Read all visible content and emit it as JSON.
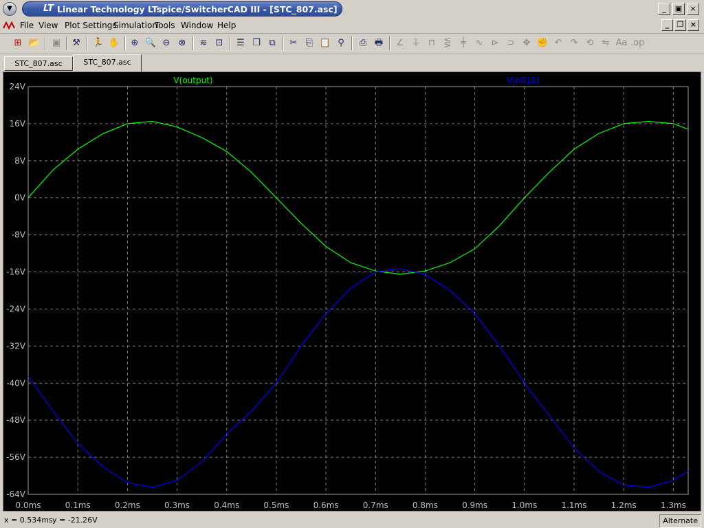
{
  "window": {
    "title": "Linear Technology LTspice/SwitcherCAD III - [STC_807.asc]",
    "logo": "LT"
  },
  "menu": [
    "File",
    "View",
    "Plot Settings",
    "Simulation",
    "Tools",
    "Window",
    "Help"
  ],
  "tabs": [
    {
      "label": "STC_807.asc",
      "active": false
    },
    {
      "label": "STC_807.asc",
      "active": true
    }
  ],
  "status": {
    "x_readout": "x = 0.534ms",
    "y_readout": "y = -21.26V",
    "mode": "Alternate"
  },
  "chart_data": {
    "type": "line",
    "title": "",
    "xlabel": "",
    "ylabel": "",
    "xlim": [
      0,
      1.33
    ],
    "ylim": [
      -64,
      24
    ],
    "grid": true,
    "x_ticks": [
      "0.0ms",
      "0.1ms",
      "0.2ms",
      "0.3ms",
      "0.4ms",
      "0.5ms",
      "0.6ms",
      "0.7ms",
      "0.8ms",
      "0.9ms",
      "1.0ms",
      "1.1ms",
      "1.2ms",
      "1.3ms"
    ],
    "y_ticks": [
      "24V",
      "16V",
      "8V",
      "0V",
      "-8V",
      "-16V",
      "-24V",
      "-32V",
      "-40V",
      "-48V",
      "-56V",
      "-64V"
    ],
    "series": [
      {
        "name": "V(output)",
        "color": "#00ff00",
        "x": [
          0,
          0.05,
          0.1,
          0.15,
          0.2,
          0.25,
          0.3,
          0.35,
          0.4,
          0.45,
          0.5,
          0.55,
          0.6,
          0.65,
          0.7,
          0.75,
          0.8,
          0.85,
          0.9,
          0.95,
          1.0,
          1.05,
          1.1,
          1.15,
          1.2,
          1.25,
          1.3,
          1.33
        ],
        "y": [
          0,
          6,
          10.5,
          13.8,
          16,
          16.5,
          15.3,
          13,
          10,
          5.5,
          0,
          -5.5,
          -10.5,
          -14,
          -15.8,
          -16.5,
          -15.8,
          -14,
          -11,
          -6,
          0,
          5.5,
          10.5,
          13.9,
          16,
          16.5,
          16,
          14.8
        ]
      },
      {
        "name": "V(n010)",
        "color": "#0000ff",
        "x": [
          0,
          0.05,
          0.1,
          0.15,
          0.2,
          0.25,
          0.3,
          0.35,
          0.4,
          0.45,
          0.5,
          0.55,
          0.6,
          0.65,
          0.7,
          0.75,
          0.8,
          0.85,
          0.9,
          0.95,
          1.0,
          1.05,
          1.1,
          1.15,
          1.2,
          1.25,
          1.3,
          1.33
        ],
        "y": [
          -38.5,
          -46,
          -53,
          -58,
          -61.5,
          -62.5,
          -61,
          -57,
          -51,
          -46,
          -40,
          -32,
          -25,
          -19.5,
          -16,
          -15.3,
          -16.5,
          -20,
          -25,
          -32,
          -40,
          -47,
          -54,
          -59,
          -62,
          -62.5,
          -61,
          -59
        ]
      }
    ]
  }
}
